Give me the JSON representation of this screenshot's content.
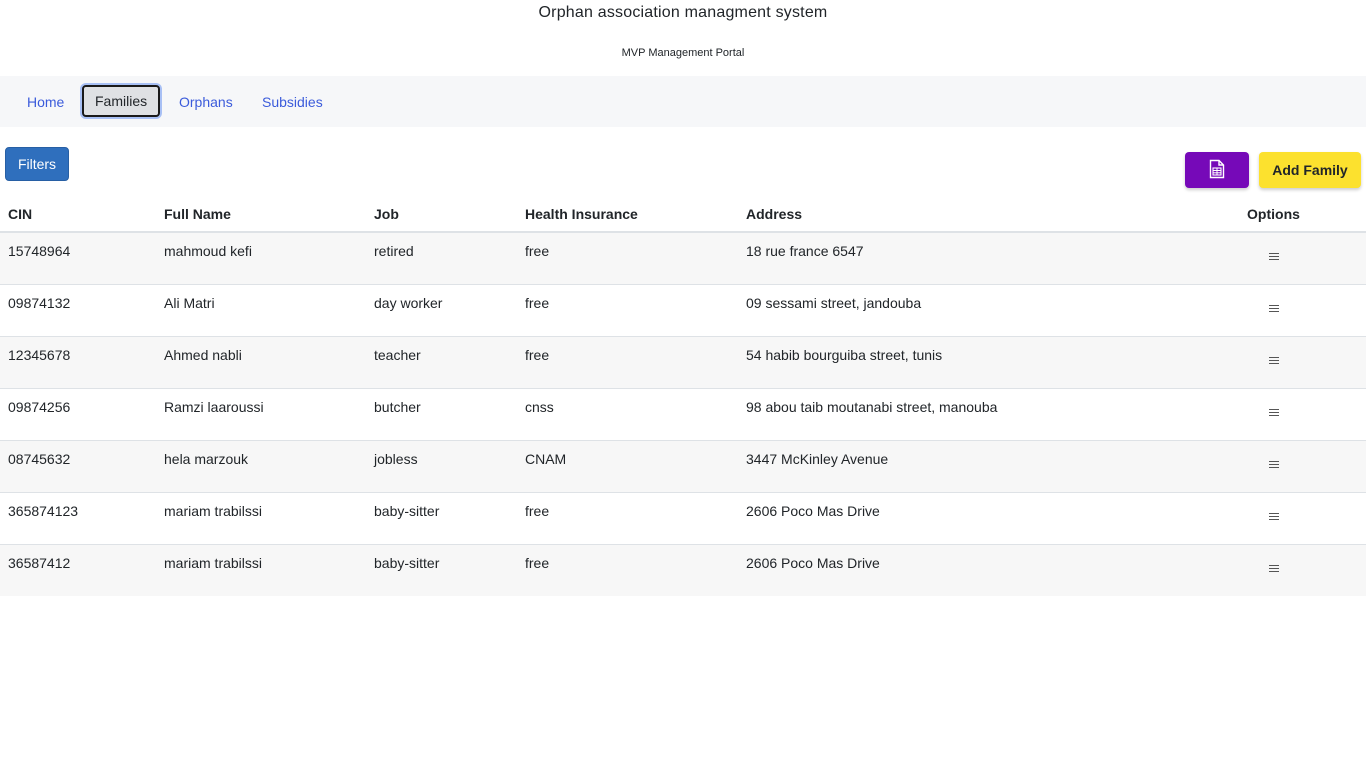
{
  "header": {
    "title": "Orphan association managment system",
    "subtitle": "MVP Management Portal"
  },
  "nav": {
    "items": [
      {
        "label": "Home",
        "active": false
      },
      {
        "label": "Families",
        "active": true
      },
      {
        "label": "Orphans",
        "active": false
      },
      {
        "label": "Subsidies",
        "active": false
      }
    ]
  },
  "toolbar": {
    "filters_label": "Filters",
    "export_icon": "spreadsheet-file-icon",
    "add_label": "Add Family"
  },
  "colors": {
    "filters": "#2f6fbd",
    "export": "#7609b8",
    "add": "#fce12e",
    "nav_link": "#3b5bdb"
  },
  "table": {
    "columns": [
      "CIN",
      "Full Name",
      "Job",
      "Health Insurance",
      "Address",
      "Options"
    ],
    "rows": [
      [
        "15748964",
        "mahmoud kefi",
        "retired",
        "free",
        "18 rue france 6547"
      ],
      [
        "09874132",
        "Ali Matri",
        "day worker",
        "free",
        "09 sessami street, jandouba"
      ],
      [
        "12345678",
        "Ahmed nabli",
        "teacher",
        "free",
        "54 habib bourguiba street, tunis"
      ],
      [
        "09874256",
        "Ramzi laaroussi",
        "butcher",
        "cnss",
        "98 abou taib moutanabi street, manouba"
      ],
      [
        "08745632",
        "hela marzouk",
        "jobless",
        "CNAM",
        "3447 McKinley Avenue"
      ],
      [
        "365874123",
        "mariam trabilssi",
        "baby-sitter",
        "free",
        "2606 Poco Mas Drive"
      ],
      [
        "36587412",
        "mariam trabilssi",
        "baby-sitter",
        "free",
        "2606 Poco Mas Drive"
      ]
    ],
    "row_menu_icon": "hamburger-menu-icon"
  }
}
